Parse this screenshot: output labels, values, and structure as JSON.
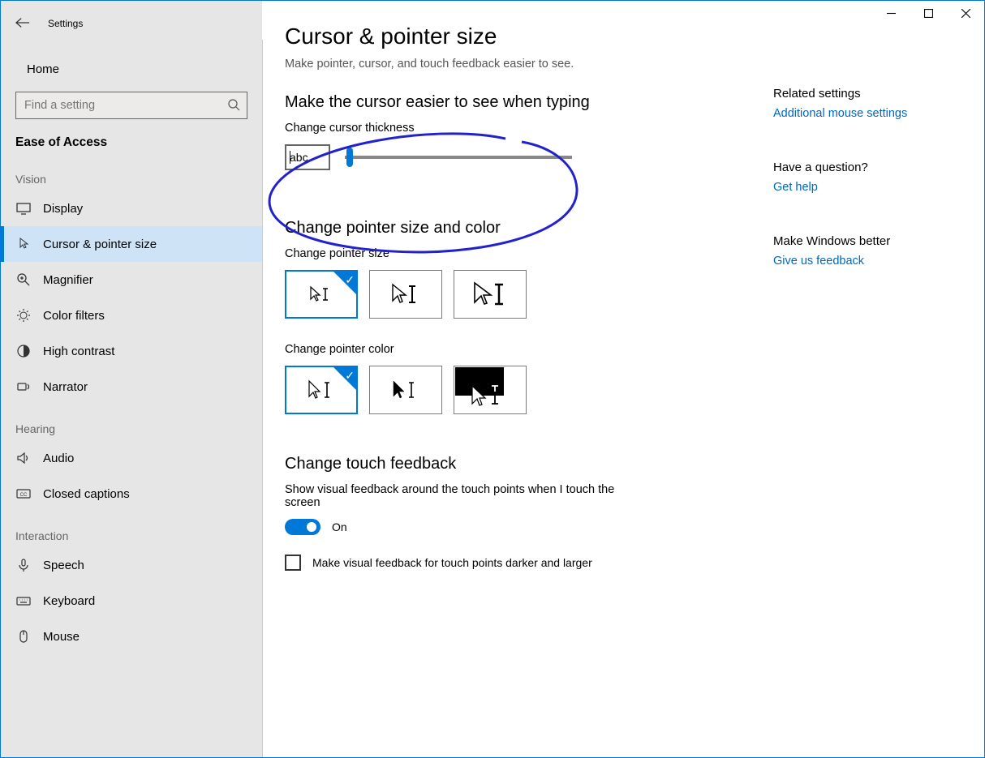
{
  "window": {
    "app_title": "Settings"
  },
  "sidebar": {
    "home": "Home",
    "search_placeholder": "Find a setting",
    "group": "Ease of Access",
    "headings": {
      "vision": "Vision",
      "hearing": "Hearing",
      "interaction": "Interaction"
    },
    "items": [
      {
        "label": "Display"
      },
      {
        "label": "Cursor & pointer size",
        "selected": true
      },
      {
        "label": "Magnifier"
      },
      {
        "label": "Color filters"
      },
      {
        "label": "High contrast"
      },
      {
        "label": "Narrator"
      },
      {
        "label": "Audio"
      },
      {
        "label": "Closed captions"
      },
      {
        "label": "Speech"
      },
      {
        "label": "Keyboard"
      },
      {
        "label": "Mouse"
      }
    ]
  },
  "page": {
    "title": "Cursor & pointer size",
    "intro": "Make pointer, cursor, and touch feedback easier to see.",
    "cursor_heading": "Make the cursor easier to see when typing",
    "thickness_label": "Change cursor thickness",
    "thickness_preview": "abc",
    "pointer_heading": "Change pointer size and color",
    "pointer_size_label": "Change pointer size",
    "pointer_color_label": "Change pointer color",
    "touch_heading": "Change touch feedback",
    "touch_desc": "Show visual feedback around the touch points when I touch the screen",
    "touch_state": "On",
    "touch_darker": "Make visual feedback for touch points darker and larger"
  },
  "aside": {
    "related_heading": "Related settings",
    "related_link": "Additional mouse settings",
    "question_heading": "Have a question?",
    "question_link": "Get help",
    "better_heading": "Make Windows better",
    "better_link": "Give us feedback"
  }
}
